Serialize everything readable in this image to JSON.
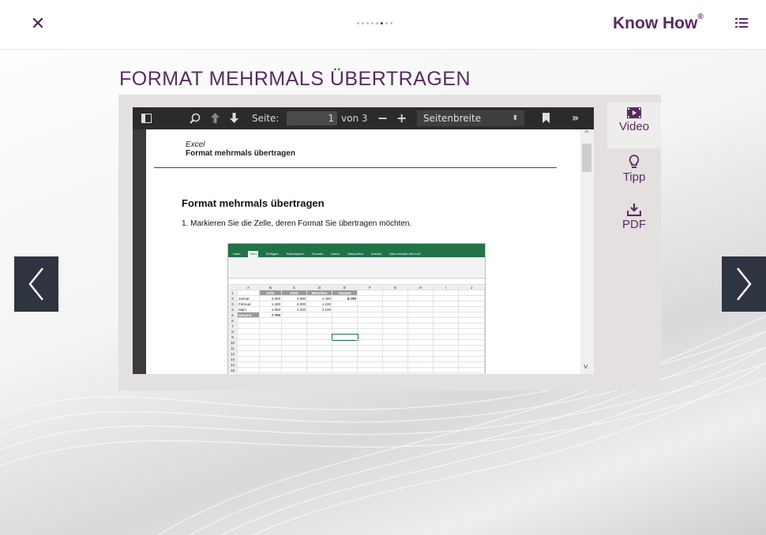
{
  "header": {
    "close_icon": "close-icon",
    "brand_text": "Know How",
    "brand_mark": "®",
    "menu_icon": "list-icon",
    "progress": {
      "total": 8,
      "current": 6
    }
  },
  "page_title": "FORMAT MEHRMALS ÜBERTRAGEN",
  "viewer": {
    "page_label": "Seite:",
    "page_value": "1",
    "page_of": "von 3",
    "zoom_option": "Seitenbreite",
    "doc": {
      "header_app": "Excel",
      "header_title": "Format mehrmals übertragen",
      "heading": "Format mehrmals übertragen",
      "step1": "1. Markieren Sie die Zelle, deren Format Sie übertragen möchten."
    },
    "excel": {
      "tabs": [
        "Datei",
        "Start",
        "Einfügen",
        "Seitenlayout",
        "Formeln",
        "Daten",
        "Überprüfen",
        "Ansicht",
        "Was möchten Sie tun?"
      ],
      "cols": [
        "A",
        "B",
        "C",
        "D",
        "E",
        "F",
        "G",
        "H",
        "I",
        "J"
      ],
      "header_row": [
        "",
        "Köln",
        "Köln",
        "München",
        "Gesamt"
      ],
      "rows": [
        [
          "Januar",
          "2.000",
          "2.500",
          "1.400",
          "6.700"
        ],
        [
          "Februar",
          "1.400",
          "2.000",
          "1.100",
          ""
        ],
        [
          "März",
          "1.900",
          "1.200",
          "1.100",
          ""
        ],
        [
          "Gesamt",
          "7.700",
          "",
          "",
          ""
        ]
      ]
    }
  },
  "side": {
    "video": "Video",
    "tipp": "Tipp",
    "pdf": "PDF"
  },
  "colors": {
    "brand": "#5a2a62",
    "nav": "#2e3440"
  }
}
